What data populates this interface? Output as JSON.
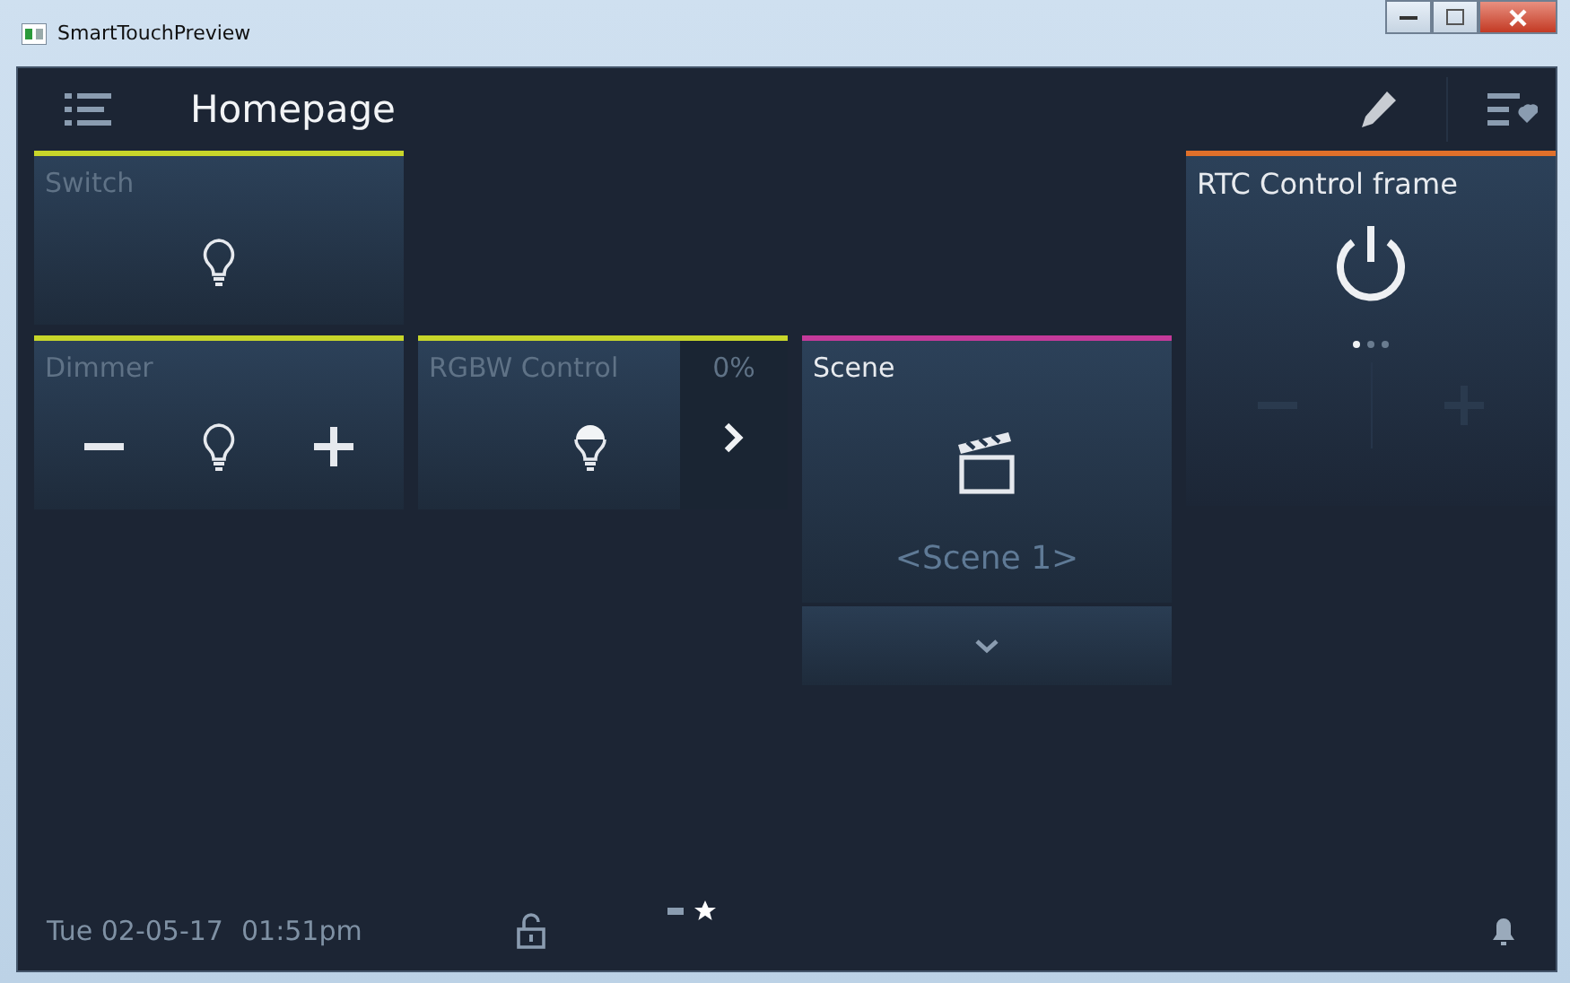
{
  "window": {
    "title": "SmartTouchPreview"
  },
  "header": {
    "title": "Homepage"
  },
  "tiles": [
    {
      "kind": "switch",
      "label": "Switch",
      "color": "#c8d62a"
    },
    {
      "kind": "rtc",
      "label": "RTC Control frame",
      "color": "#e0702a",
      "pages": [
        {
          "selected": true
        },
        {
          "selected": false
        },
        {
          "selected": false
        }
      ]
    },
    {
      "kind": "dimmer",
      "label": "Dimmer",
      "color": "#c8d62a"
    },
    {
      "kind": "rgbw",
      "label": "RGBW Control",
      "color": "#c8d62a",
      "reading": "0%"
    },
    {
      "kind": "scene",
      "label": "Scene",
      "color": "#c43a9a",
      "value": "<Scene 1>"
    }
  ],
  "footer": {
    "date": "Tue 02-05-17",
    "time": "01:51pm",
    "pages": [
      {
        "kind": "page",
        "selected": false
      },
      {
        "kind": "favorites",
        "selected": true
      }
    ]
  }
}
